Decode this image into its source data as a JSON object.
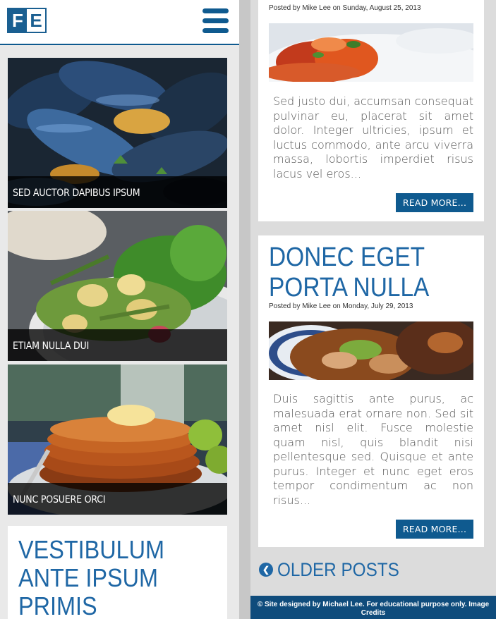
{
  "brand": {
    "logo_left": "F",
    "logo_right": "E"
  },
  "left_tiles": [
    {
      "label": "SED AUCTOR DAPIBUS IPSUM",
      "image": "mussels-photo"
    },
    {
      "label": "ETIAM NULLA DUI",
      "image": "salad-photo"
    },
    {
      "label": "NUNC POSUERE ORCI",
      "image": "pancakes-photo"
    }
  ],
  "left_post": {
    "title": "VESTIBULUM ANTE IPSUM PRIMIS"
  },
  "posts": [
    {
      "meta": "Posted by Mike Lee on Sunday, August 25, 2013",
      "image": "pasta-photo",
      "excerpt": "Sed justo dui, accumsan consequat pulvinar eu, placerat sit amet dolor. Integer ultricies, ipsum et luctus commodo, ante arcu viverra massa, lobortis imperdiet risus lacus vel eros...",
      "read_more": "READ MORE..."
    },
    {
      "title": "DONEC EGET PORTA NULLA",
      "meta": "Posted by Mike Lee on Monday, July 29, 2013",
      "image": "ramen-photo",
      "excerpt": "Duis sagittis ante purus, ac malesuada erat ornare non. Sed sit amet nisl elit. Fusce molestie quam nisl, quis blandit nisi pellentesque sed. Quisque et ante purus. Integer et nunc eget eros tempor condimentum ac non risus...",
      "read_more": "READ MORE..."
    }
  ],
  "pagination": {
    "older_label": "OLDER POSTS",
    "icon": "chevron-left-circle-icon"
  },
  "footer": {
    "text": "© Site designed by Michael Lee. For educational purpose only. Image Credits"
  },
  "colors": {
    "brand_blue": "#0f5a8f",
    "title_blue": "#1f67a5"
  }
}
